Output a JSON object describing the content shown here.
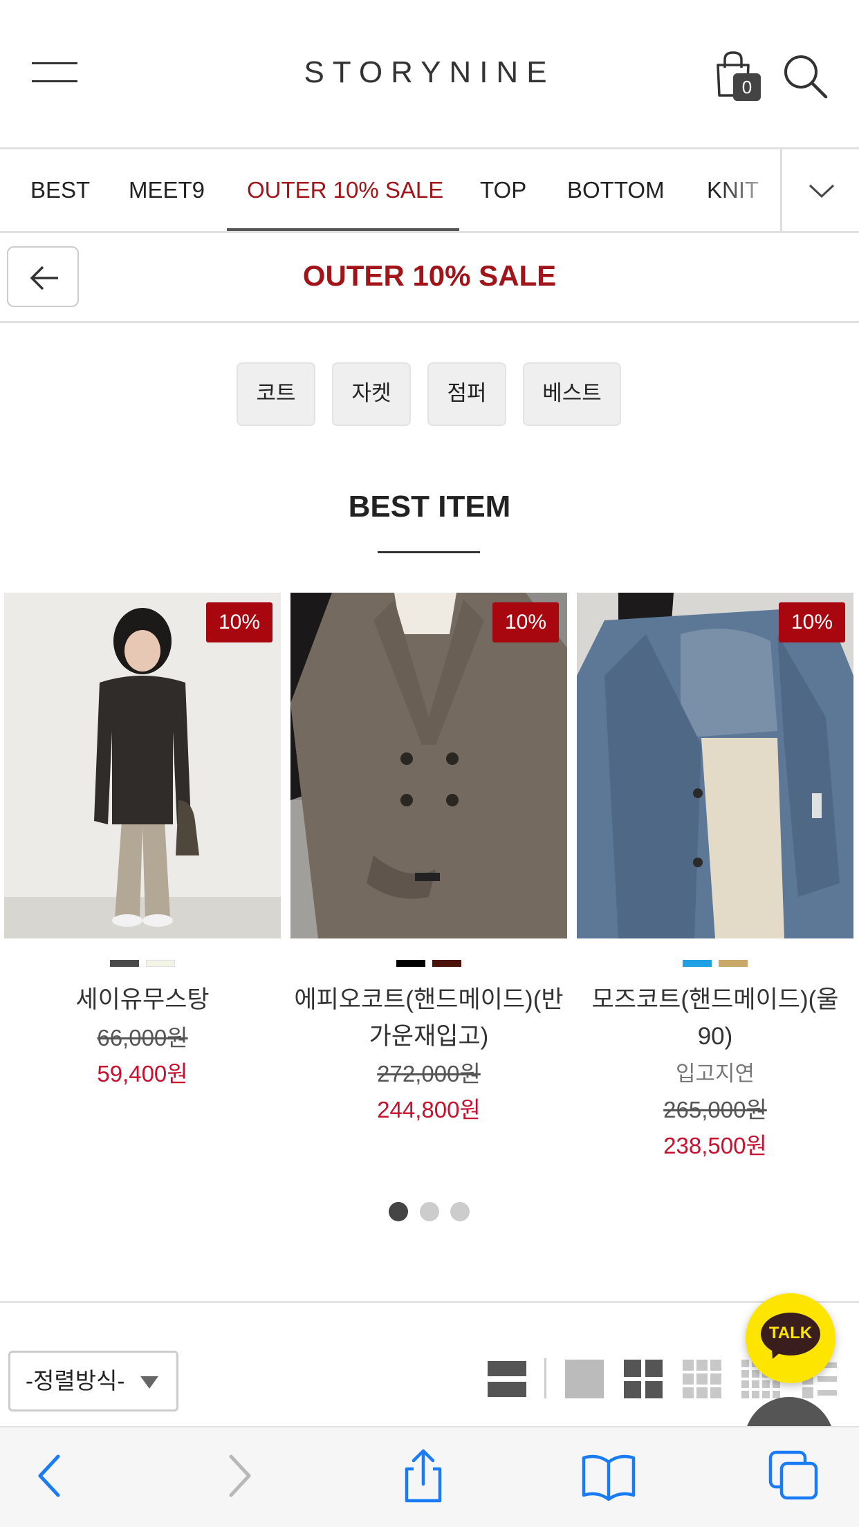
{
  "header": {
    "logo": "STORYNINE",
    "cart_count": "0"
  },
  "catnav": {
    "items": [
      "BEST",
      "MEET9",
      "OUTER 10% SALE",
      "TOP",
      "BOTTOM",
      "KNIT"
    ],
    "active_index": 2
  },
  "subheader": {
    "title": "OUTER 10% SALE"
  },
  "subcategories": [
    "코트",
    "자켓",
    "점퍼",
    "베스트"
  ],
  "best_section": {
    "title": "BEST ITEM"
  },
  "products": [
    {
      "badge": "10%",
      "name": "세이유무스탕",
      "swatches": [
        "#4a4a4a",
        "#f4f4e4"
      ],
      "note": "",
      "original_price": "66,000원",
      "sale_price": "59,400원"
    },
    {
      "badge": "10%",
      "name": "에피오코트(핸드메이드)(반가운재입고)",
      "swatches": [
        "#000000",
        "#4a1208"
      ],
      "note": "",
      "original_price": "272,000원",
      "sale_price": "244,800원"
    },
    {
      "badge": "10%",
      "name": "모즈코트(핸드메이드)(울90)",
      "swatches": [
        "#1ea0e4",
        "#c9a86a"
      ],
      "note": "입고지연",
      "original_price": "265,000원",
      "sale_price": "238,500원"
    }
  ],
  "pager": {
    "count": 3,
    "active": 0
  },
  "sort": {
    "label": "-정렬방식-"
  },
  "talk": {
    "label": "TALK"
  },
  "colors": {
    "accent": "#a0141a",
    "badge": "#a8070f",
    "sale_price": "#c8102e",
    "kakao_yellow": "#fde500",
    "ios_blue": "#1a7cf4"
  }
}
